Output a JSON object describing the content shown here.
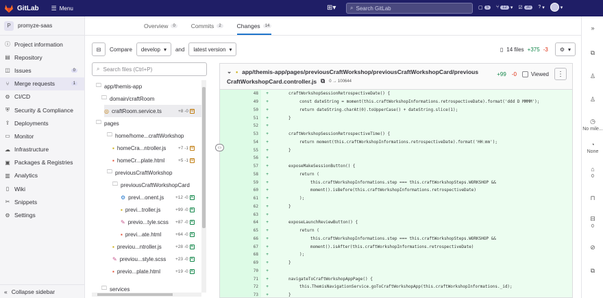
{
  "topbar": {
    "brand": "GitLab",
    "menu_label": "Menu",
    "search_placeholder": "Search GitLab",
    "issues_count": "5",
    "mr_count": "12",
    "todos_count": "30",
    "accent": "#1f1e66"
  },
  "sidebar": {
    "project_initial": "P",
    "project_name": "promyze-saas",
    "items": [
      {
        "label": "Project information",
        "icon": "info-icon"
      },
      {
        "label": "Repository",
        "icon": "repo-icon"
      },
      {
        "label": "Issues",
        "icon": "issues-icon",
        "badge": "0"
      },
      {
        "label": "Merge requests",
        "icon": "merge-icon",
        "badge": "1"
      },
      {
        "label": "CI/CD",
        "icon": "rocket-icon"
      },
      {
        "label": "Security & Compliance",
        "icon": "shield-icon"
      },
      {
        "label": "Deployments",
        "icon": "deploy-icon"
      },
      {
        "label": "Monitor",
        "icon": "monitor-icon"
      },
      {
        "label": "Infrastructure",
        "icon": "cloud-icon"
      },
      {
        "label": "Packages & Registries",
        "icon": "package-icon"
      },
      {
        "label": "Analytics",
        "icon": "chart-icon"
      },
      {
        "label": "Wiki",
        "icon": "book-icon"
      },
      {
        "label": "Snippets",
        "icon": "snippet-icon"
      },
      {
        "label": "Settings",
        "icon": "gear-icon"
      }
    ],
    "collapse_label": "Collapse sidebar"
  },
  "tabs": [
    {
      "label": "Overview",
      "count": "0"
    },
    {
      "label": "Commits",
      "count": "2"
    },
    {
      "label": "Changes",
      "count": "14"
    }
  ],
  "toolbar": {
    "compare_label": "Compare",
    "branch": "develop",
    "and_label": "and",
    "version": "latest version",
    "files_label": "14 files",
    "additions": "+375",
    "deletions": "-3"
  },
  "filesearch": {
    "placeholder": "Search files (Ctrl+P)"
  },
  "tree": [
    {
      "type": "folder",
      "label": "app/themis-app"
    },
    {
      "type": "folder",
      "label": "domain/craftRoom"
    },
    {
      "type": "file",
      "label": "craftRoom.service.ts",
      "stat": "+8 -0",
      "status": "M"
    },
    {
      "type": "folder",
      "label": "pages"
    },
    {
      "type": "folder",
      "label": "home/home...craftWorkshop"
    },
    {
      "type": "file",
      "label": "homeCra...ntroller.js",
      "stat": "+7 -1",
      "status": "M"
    },
    {
      "type": "file",
      "label": "homeCr...plate.html",
      "stat": "+5 -1",
      "status": "M"
    },
    {
      "type": "folder",
      "label": "previousCraftWorkshop"
    },
    {
      "type": "folder",
      "label": "previousCraftWorkshopCard"
    },
    {
      "type": "file",
      "label": "previ...onent.js",
      "stat": "+12 -0",
      "status": "A"
    },
    {
      "type": "file",
      "label": "previ...troller.js",
      "stat": "+99 -0",
      "status": "A"
    },
    {
      "type": "file",
      "label": "previo...tyle.scss",
      "stat": "+87 -0",
      "status": "A"
    },
    {
      "type": "file",
      "label": "previ...ate.html",
      "stat": "+64 -0",
      "status": "A"
    },
    {
      "type": "file",
      "label": "previou...ntroller.js",
      "stat": "+28 -0",
      "status": "A"
    },
    {
      "type": "file",
      "label": "previou...style.scss",
      "stat": "+23 -0",
      "status": "A"
    },
    {
      "type": "file",
      "label": "previo...plate.html",
      "stat": "+19 -0",
      "status": "A"
    },
    {
      "type": "folder",
      "label": "services"
    }
  ],
  "file": {
    "path_line1": "app/themis-app/pages/previousCraftWorkshop/previousCraftWorkshopCard/previous",
    "path_line2": "CraftWorkshopCard.controller.js",
    "mode": "0 → 100644",
    "additions": "+99",
    "deletions": "-0",
    "viewed_label": "Viewed"
  },
  "diff": [
    {
      "n": "48",
      "code": "craftWorkshopSessionRetrospectiveDate() {",
      "indent": 1
    },
    {
      "n": "49",
      "code": "const dateString = moment(this.craftWorkshopInformations.retrospectiveDate).format('ddd D MMMM');",
      "indent": 2
    },
    {
      "n": "50",
      "code": "return dateString.charAt(0).toUpperCase() + dateString.slice(1);",
      "indent": 2
    },
    {
      "n": "51",
      "code": "}",
      "indent": 1
    },
    {
      "n": "52",
      "code": "",
      "indent": 0
    },
    {
      "n": "53",
      "code": "craftWorkshopSessionRetrospectiveTime() {",
      "indent": 1
    },
    {
      "n": "54",
      "code": "return moment(this.craftWorkshopInformations.retrospectiveDate).format('HH:mm');",
      "indent": 2
    },
    {
      "n": "55",
      "code": "}",
      "indent": 1
    },
    {
      "n": "56",
      "code": "",
      "indent": 0
    },
    {
      "n": "57",
      "code": "exposeMakeSessionButton() {",
      "indent": 1
    },
    {
      "n": "58",
      "code": "return (",
      "indent": 2
    },
    {
      "n": "59",
      "code": "this.craftWorkshopInformations.step === this.craftWorkshopSteps.WORKSHOP &&",
      "indent": 3
    },
    {
      "n": "60",
      "code": "moment().isBefore(this.craftWorkshopInformations.retrospectiveDate)",
      "indent": 3
    },
    {
      "n": "61",
      "code": ");",
      "indent": 2
    },
    {
      "n": "62",
      "code": "}",
      "indent": 1
    },
    {
      "n": "63",
      "code": "",
      "indent": 0
    },
    {
      "n": "64",
      "code": "exposeLaunchReviewButton() {",
      "indent": 1
    },
    {
      "n": "65",
      "code": "return (",
      "indent": 2
    },
    {
      "n": "66",
      "code": "this.craftWorkshopInformations.step === this.craftWorkshopSteps.WORKSHOP &&",
      "indent": 3
    },
    {
      "n": "67",
      "code": "moment().isAfter(this.craftWorkshopInformations.retrospectiveDate)",
      "indent": 3
    },
    {
      "n": "68",
      "code": ");",
      "indent": 2
    },
    {
      "n": "69",
      "code": "}",
      "indent": 1
    },
    {
      "n": "70",
      "code": "",
      "indent": 0
    },
    {
      "n": "71",
      "code": "navigateToCraftWorkshopAppPage() {",
      "indent": 1
    },
    {
      "n": "72",
      "code": "this.ThemisNavigationService.goToCraftWorkshopApp(this.craftWorkshopInformations._id);",
      "indent": 2
    },
    {
      "n": "73",
      "code": "}",
      "indent": 1
    }
  ],
  "rightbar": {
    "milestone": "No mile...",
    "time": "None",
    "labels": "0",
    "weight": "0"
  }
}
